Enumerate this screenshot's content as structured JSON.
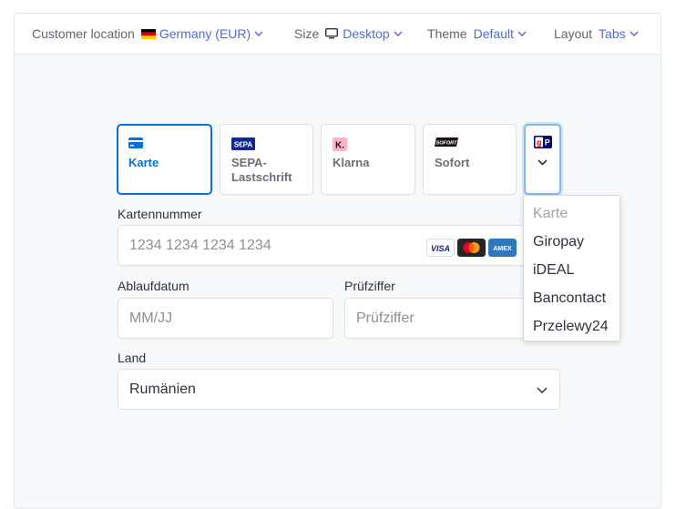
{
  "topbar": {
    "customer_location": {
      "label": "Customer location",
      "value": "Germany (EUR)"
    },
    "size": {
      "label": "Size",
      "value": "Desktop"
    },
    "theme": {
      "label": "Theme",
      "value": "Default"
    },
    "layout": {
      "label": "Layout",
      "value": "Tabs"
    }
  },
  "tabs": [
    {
      "label": "Karte"
    },
    {
      "label_line1": "SEPA-",
      "label_line2": "Lastschrift",
      "logo_text": "S€PA"
    },
    {
      "label": "Klarna",
      "logo_text": "K."
    },
    {
      "label": "Sofort",
      "logo_text": "SOFORT"
    }
  ],
  "more_tab": {
    "logo_text": "gP"
  },
  "card_number": {
    "label": "Kartennummer",
    "placeholder": "1234 1234 1234 1234"
  },
  "expiry": {
    "label": "Ablaufdatum",
    "placeholder": "MM/JJ"
  },
  "cvc": {
    "label": "Prüfziffer",
    "placeholder": "Prüfziffer"
  },
  "country": {
    "label": "Land",
    "value": "Rumänien"
  },
  "card_brands": {
    "visa": "VISA",
    "amex": "AMEX"
  },
  "dropdown": {
    "items": [
      {
        "label": "Karte",
        "disabled": true
      },
      {
        "label": "Giropay"
      },
      {
        "label": "iDEAL"
      },
      {
        "label": "Bancontact"
      },
      {
        "label": "Przelewy24"
      }
    ]
  },
  "colors": {
    "accent": "#0570de",
    "link": "#5469d4",
    "background": "#f6f8fa"
  }
}
